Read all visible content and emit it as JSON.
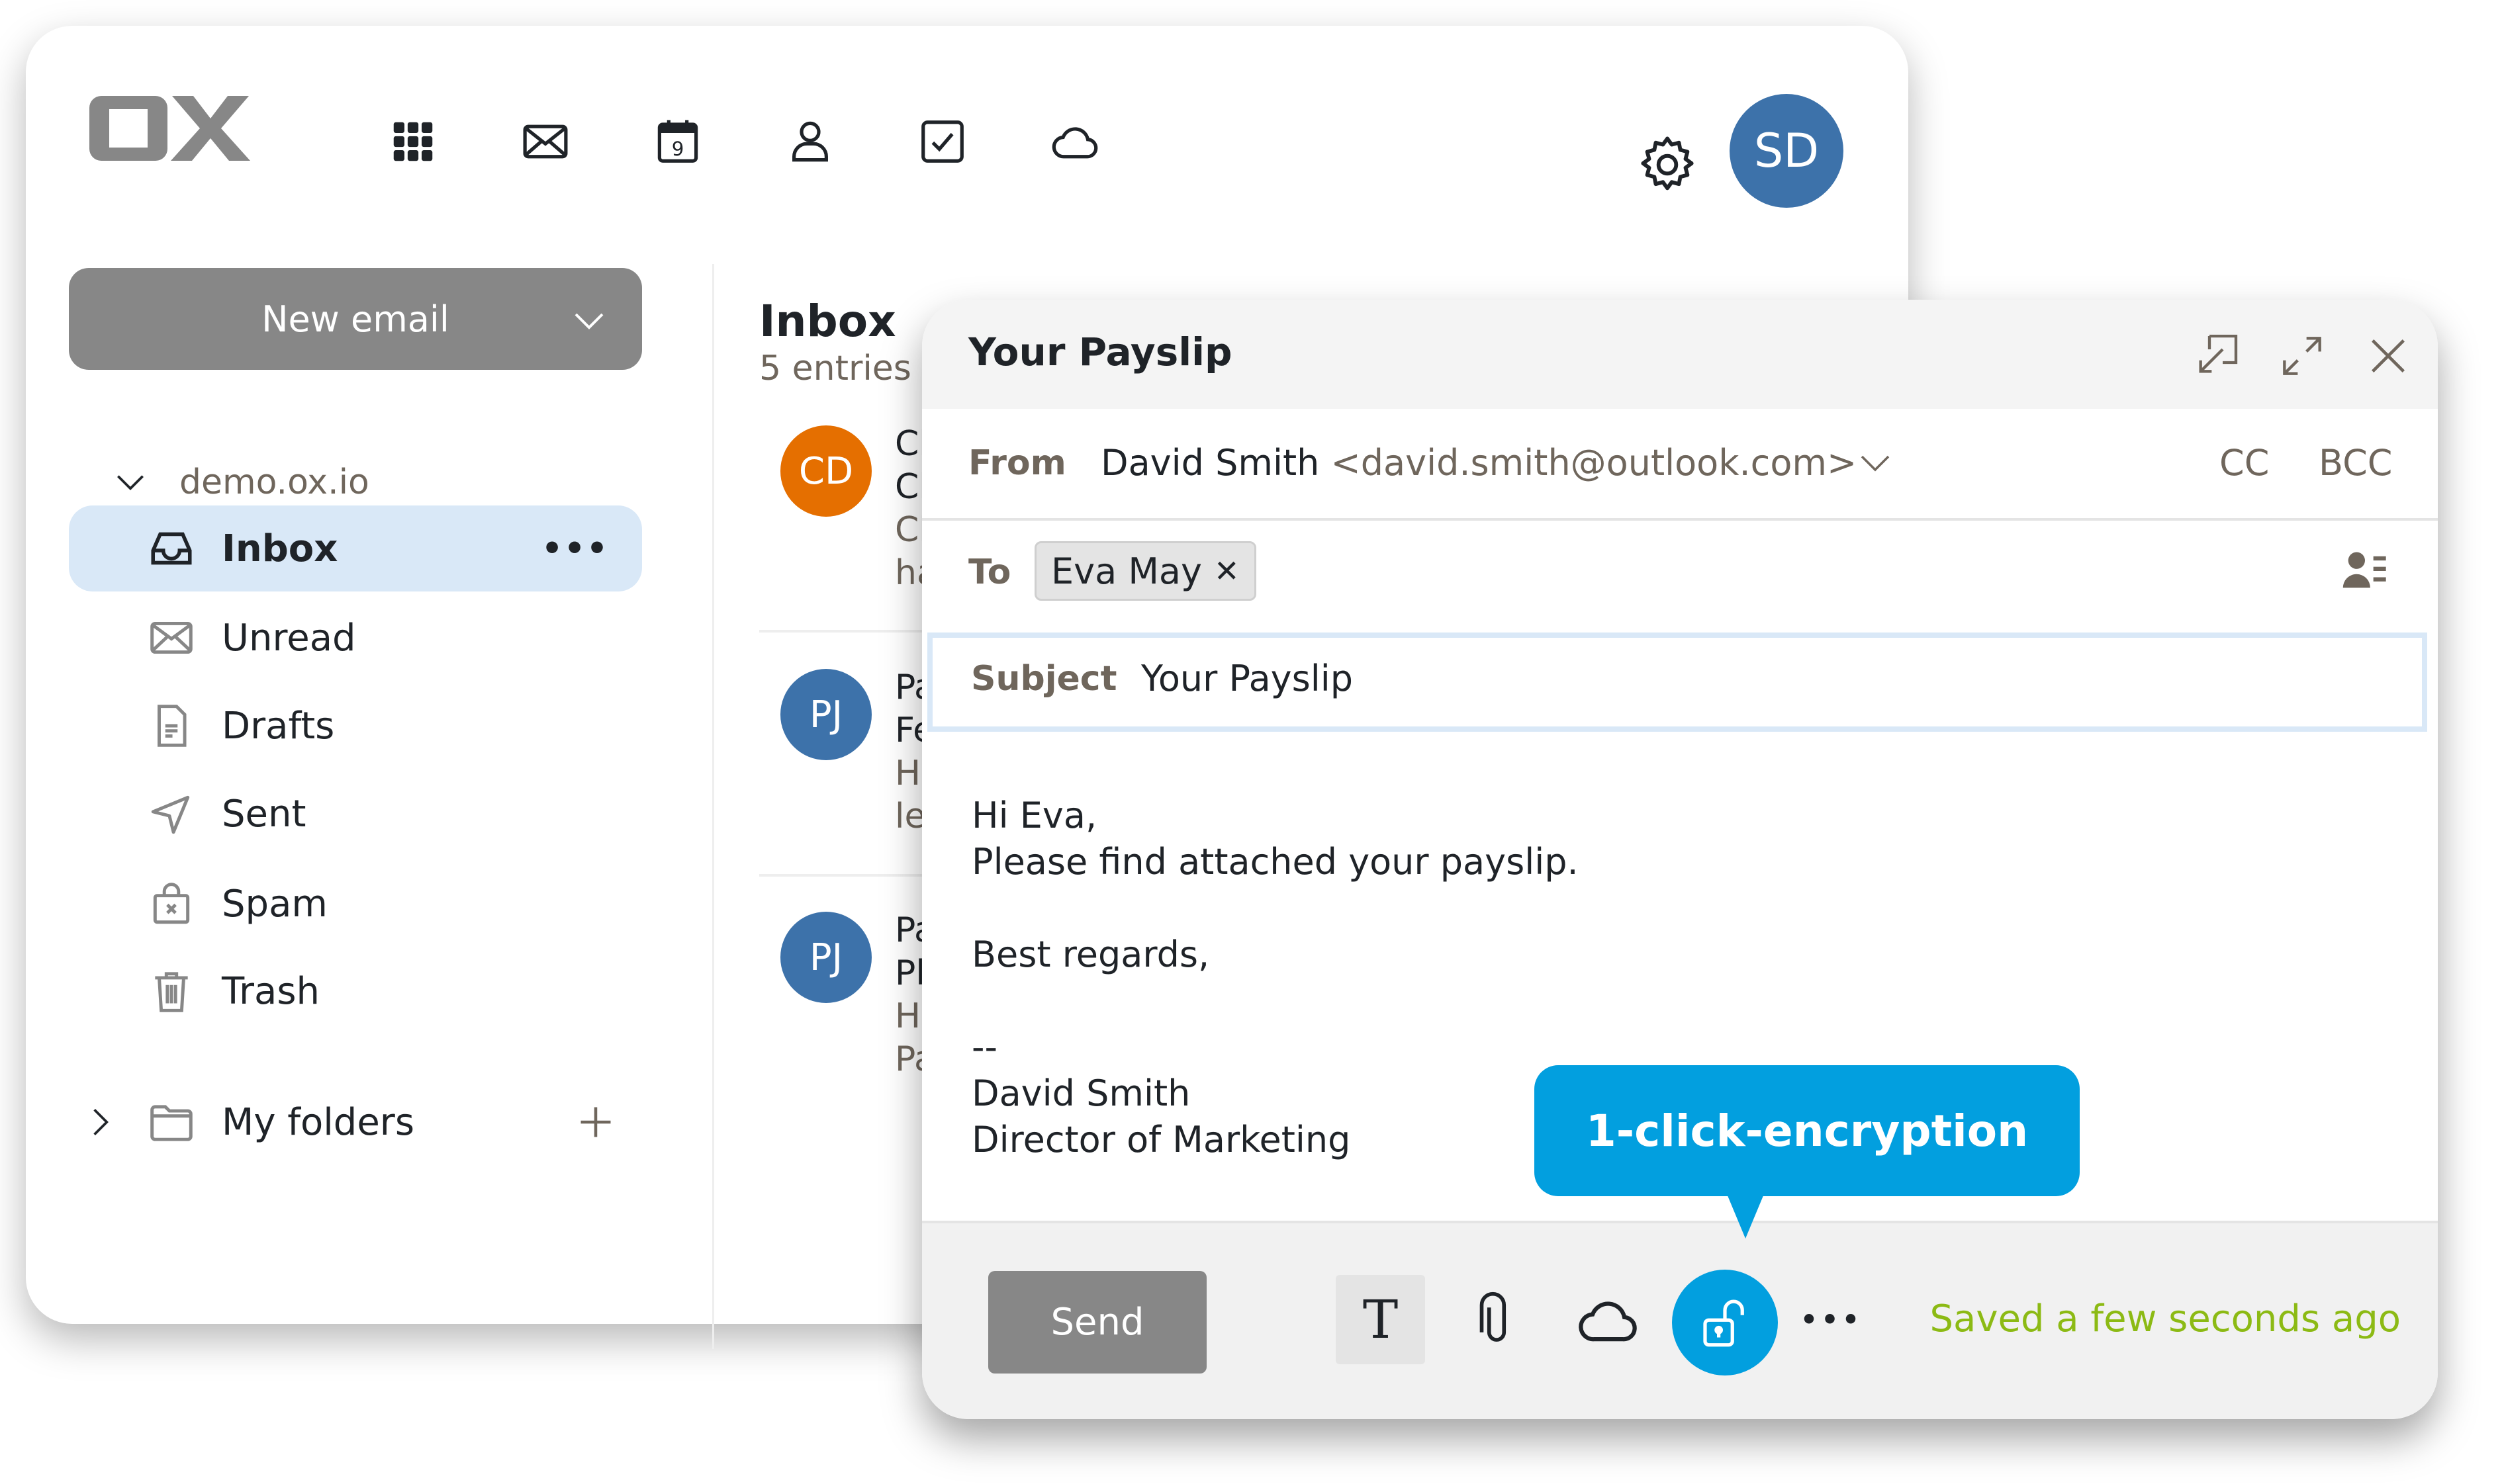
{
  "app": {
    "logo_text": "OX",
    "nav_icons": [
      "apps-grid-icon",
      "mail-icon",
      "calendar-icon",
      "contacts-icon",
      "tasks-icon",
      "drive-cloud-icon"
    ],
    "calendar_day": "9",
    "user_initials": "SD",
    "avatar_color": "#3d72aa"
  },
  "sidebar": {
    "new_email_label": "New email",
    "account": "demo.ox.io",
    "folders": [
      {
        "label": "Inbox",
        "icon": "inbox-icon",
        "selected": true
      },
      {
        "label": "Unread",
        "icon": "envelope-icon"
      },
      {
        "label": "Drafts",
        "icon": "document-icon"
      },
      {
        "label": "Sent",
        "icon": "send-icon"
      },
      {
        "label": "Spam",
        "icon": "spam-bag-icon"
      },
      {
        "label": "Trash",
        "icon": "trash-icon"
      }
    ],
    "my_folders_label": "My folders"
  },
  "list": {
    "title": "Inbox",
    "count": "5 entries",
    "messages": [
      {
        "initials": "CD",
        "color": "#e56f00",
        "lines": [
          "Chr",
          "Chr",
          "Chr",
          "has"
        ]
      },
      {
        "initials": "PJ",
        "color": "#3d72aa",
        "lines": [
          "Pau",
          "Fee",
          "Hi I",
          "let"
        ]
      },
      {
        "initials": "PJ",
        "color": "#3d72aa",
        "lines": [
          "Pau",
          "Ple",
          "Her",
          "Pau"
        ]
      }
    ]
  },
  "compose": {
    "title": "Your Payslip",
    "from_label": "From",
    "from_name": "David Smith",
    "from_email": "<david.smith@outlook.com>",
    "cc_label": "CC",
    "bcc_label": "BCC",
    "to_label": "To",
    "to_recipient": "Eva May",
    "subject_label": "Subject",
    "subject_value": "Your Payslip",
    "body_lines": [
      "Hi Eva,",
      "Please find attached your payslip.",
      "",
      "Best regards,",
      "",
      "--",
      "David Smith",
      "Director of Marketing"
    ],
    "send_label": "Send",
    "text_format_label": "T",
    "more_label": "•••",
    "saved_status": "Saved a few seconds ago",
    "saved_color": "#8cba14",
    "encryption_color": "#029fdf"
  },
  "tooltip": {
    "text": "1-click-encryption"
  }
}
